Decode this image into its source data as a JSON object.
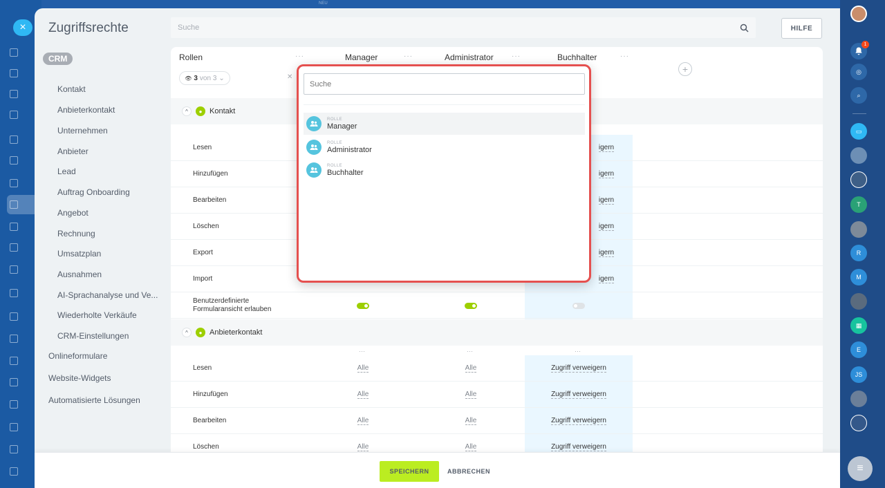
{
  "top": {
    "neu_label": "NEU"
  },
  "title": "Zugriffsrechte",
  "search": {
    "placeholder": "Suche"
  },
  "help_label": "HILFE",
  "sidebar": {
    "badge": "CRM",
    "items": [
      "Kontakt",
      "Anbieterkontakt",
      "Unternehmen",
      "Anbieter",
      "Lead",
      "Auftrag Onboarding",
      "Angebot",
      "Rechnung",
      "Umsatzplan",
      "Ausnahmen",
      "AI-Sprachanalyse und Ve...",
      "Wiederholte Verkäufe",
      "CRM-Einstellungen"
    ],
    "top_items": [
      "Onlineformulare",
      "Website-Widgets",
      "Automatisierte Lösungen"
    ]
  },
  "table": {
    "roles_header": "Rollen",
    "role_count": {
      "num": "3",
      "rest": "von 3"
    },
    "columns": [
      "Manager",
      "Administrator",
      "Buchhalter"
    ],
    "sections": [
      {
        "name": "Kontakt",
        "rows": [
          {
            "label": "Lesen",
            "values": [
              "",
              "",
              "Zugriff verweigern"
            ]
          },
          {
            "label": "Hinzufügen",
            "values": [
              "",
              "",
              "Zugriff verweigern"
            ]
          },
          {
            "label": "Bearbeiten",
            "values": [
              "",
              "",
              "Zugriff verweigern"
            ]
          },
          {
            "label": "Löschen",
            "values": [
              "",
              "",
              "Zugriff verweigern"
            ]
          },
          {
            "label": "Export",
            "values": [
              "",
              "",
              "Zugriff verweigern"
            ]
          },
          {
            "label": "Import",
            "values": [
              "",
              "",
              "Zugriff verweigern"
            ]
          }
        ],
        "toggle_row": {
          "label_line1": "Benutzerdefinierte",
          "label_line2": "Formularansicht erlauben"
        }
      },
      {
        "name": "Anbieterkontakt",
        "rows": [
          {
            "label": "Lesen",
            "values": [
              "Alle",
              "Alle",
              "Zugriff verweigern"
            ]
          },
          {
            "label": "Hinzufügen",
            "values": [
              "Alle",
              "Alle",
              "Zugriff verweigern"
            ]
          },
          {
            "label": "Bearbeiten",
            "values": [
              "Alle",
              "Alle",
              "Zugriff verweigern"
            ]
          },
          {
            "label": "Löschen",
            "values": [
              "Alle",
              "Alle",
              "Zugriff verweigern"
            ]
          }
        ]
      }
    ],
    "deny_partial": "igern"
  },
  "popup": {
    "search_placeholder": "Suche",
    "items": [
      {
        "caption": "ROLLE",
        "name": "Manager"
      },
      {
        "caption": "ROLLE",
        "name": "Administrator"
      },
      {
        "caption": "ROLLE",
        "name": "Buchhalter"
      }
    ]
  },
  "footer": {
    "save": "SPEICHERN",
    "cancel": "ABBRECHEN"
  },
  "rail": {
    "notification_count": "1",
    "avatar_letters": [
      "T",
      "R",
      "M",
      "E",
      "JS"
    ]
  }
}
